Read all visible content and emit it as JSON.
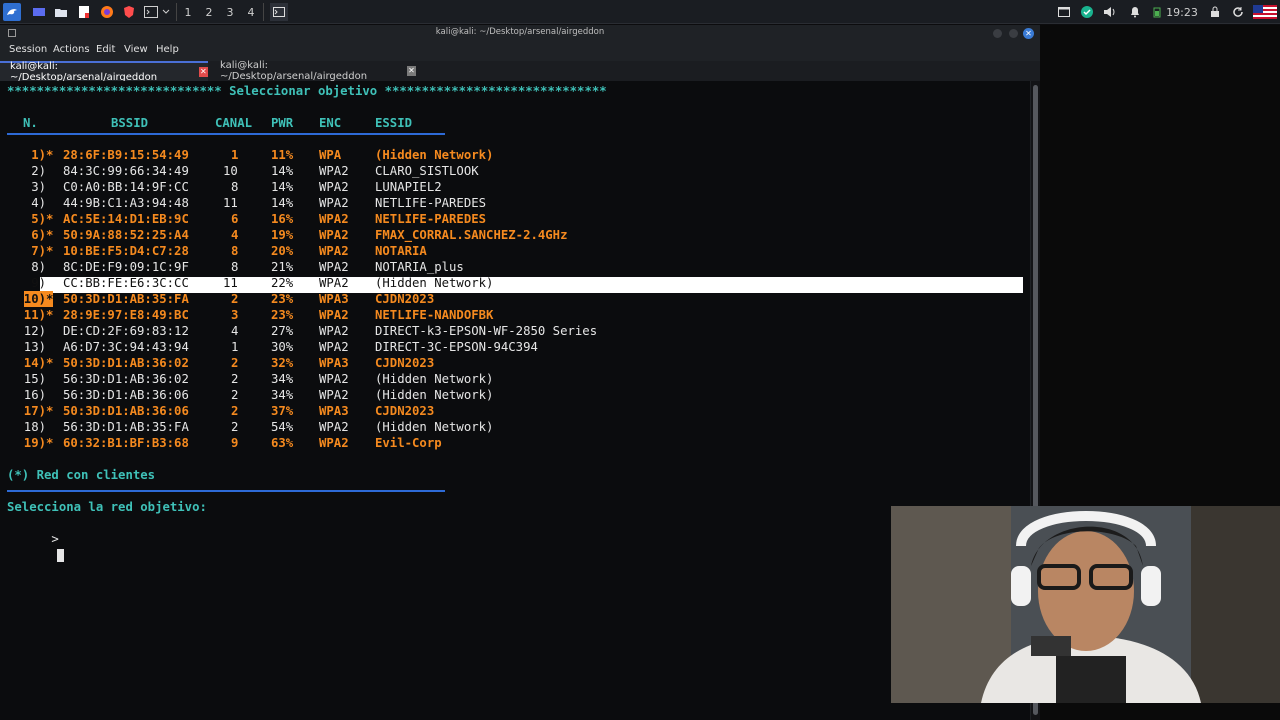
{
  "panel": {
    "workspaces": [
      "1",
      "2",
      "3",
      "4"
    ],
    "clock": "19:23"
  },
  "window": {
    "title": "kali@kali: ~/Desktop/arsenal/airgeddon",
    "menu": [
      "Session",
      "Actions",
      "Edit",
      "View",
      "Help"
    ],
    "tabs": [
      {
        "label": "kali@kali: ~/Desktop/arsenal/airgeddon"
      },
      {
        "label": "kali@kali: ~/Desktop/arsenal/airgeddon"
      }
    ]
  },
  "terminal": {
    "header": "***************************** Seleccionar objetivo ******************************",
    "columns": {
      "n": "N.",
      "bssid": "BSSID",
      "canal": "CANAL",
      "pwr": "PWR",
      "enc": "ENC",
      "essid": "ESSID"
    },
    "rows": [
      {
        "n": "1)*",
        "bssid": "28:6F:B9:15:54:49",
        "canal": "1",
        "pwr": "11%",
        "enc": "WPA",
        "essid": "(Hidden Network)",
        "clients": true
      },
      {
        "n": "2)",
        "bssid": "84:3C:99:66:34:49",
        "canal": "10",
        "pwr": "14%",
        "enc": "WPA2",
        "essid": "CLARO_SISTLOOK",
        "clients": false
      },
      {
        "n": "3)",
        "bssid": "C0:A0:BB:14:9F:CC",
        "canal": "8",
        "pwr": "14%",
        "enc": "WPA2",
        "essid": "LUNAPIEL2",
        "clients": false
      },
      {
        "n": "4)",
        "bssid": "44:9B:C1:A3:94:48",
        "canal": "11",
        "pwr": "14%",
        "enc": "WPA2",
        "essid": "NETLIFE-PAREDES",
        "clients": false
      },
      {
        "n": "5)*",
        "bssid": "AC:5E:14:D1:EB:9C",
        "canal": "6",
        "pwr": "16%",
        "enc": "WPA2",
        "essid": "NETLIFE-PAREDES",
        "clients": true
      },
      {
        "n": "6)*",
        "bssid": "50:9A:88:52:25:A4",
        "canal": "4",
        "pwr": "19%",
        "enc": "WPA2",
        "essid": "FMAX_CORRAL.SANCHEZ-2.4GHz",
        "clients": true
      },
      {
        "n": "7)*",
        "bssid": "10:BE:F5:D4:C7:28",
        "canal": "8",
        "pwr": "20%",
        "enc": "WPA2",
        "essid": "NOTARIA",
        "clients": true
      },
      {
        "n": "8)",
        "bssid": "8C:DE:F9:09:1C:9F",
        "canal": "8",
        "pwr": "21%",
        "enc": "WPA2",
        "essid": "NOTARIA_plus",
        "clients": false
      },
      {
        "n": "9)",
        "bssid": "CC:BB:FE:E6:3C:CC",
        "canal": "11",
        "pwr": "22%",
        "enc": "WPA2",
        "essid": "(Hidden Network)",
        "clients": false
      },
      {
        "n": "10)*",
        "bssid": "50:3D:D1:AB:35:FA",
        "canal": "2",
        "pwr": "23%",
        "enc": "WPA3",
        "essid": "CJDN2023",
        "clients": true
      },
      {
        "n": "11)*",
        "bssid": "28:9E:97:E8:49:BC",
        "canal": "3",
        "pwr": "23%",
        "enc": "WPA2",
        "essid": "NETLIFE-NANDOFBK",
        "clients": true
      },
      {
        "n": "12)",
        "bssid": "DE:CD:2F:69:83:12",
        "canal": "4",
        "pwr": "27%",
        "enc": "WPA2",
        "essid": "DIRECT-k3-EPSON-WF-2850 Series",
        "clients": false
      },
      {
        "n": "13)",
        "bssid": "A6:D7:3C:94:43:94",
        "canal": "1",
        "pwr": "30%",
        "enc": "WPA2",
        "essid": "DIRECT-3C-EPSON-94C394",
        "clients": false
      },
      {
        "n": "14)*",
        "bssid": "50:3D:D1:AB:36:02",
        "canal": "2",
        "pwr": "32%",
        "enc": "WPA3",
        "essid": "CJDN2023",
        "clients": true
      },
      {
        "n": "15)",
        "bssid": "56:3D:D1:AB:36:02",
        "canal": "2",
        "pwr": "34%",
        "enc": "WPA2",
        "essid": "(Hidden Network)",
        "clients": false
      },
      {
        "n": "16)",
        "bssid": "56:3D:D1:AB:36:06",
        "canal": "2",
        "pwr": "34%",
        "enc": "WPA2",
        "essid": "(Hidden Network)",
        "clients": false
      },
      {
        "n": "17)*",
        "bssid": "50:3D:D1:AB:36:06",
        "canal": "2",
        "pwr": "37%",
        "enc": "WPA3",
        "essid": "CJDN2023",
        "clients": true
      },
      {
        "n": "18)",
        "bssid": "56:3D:D1:AB:35:FA",
        "canal": "2",
        "pwr": "54%",
        "enc": "WPA2",
        "essid": "(Hidden Network)",
        "clients": false
      },
      {
        "n": "19)*",
        "bssid": "60:32:B1:BF:B3:68",
        "canal": "9",
        "pwr": "63%",
        "enc": "WPA2",
        "essid": "Evil-Corp",
        "clients": true
      }
    ],
    "legend": "(*) Red con clientes",
    "prompt_title": "Selecciona la red objetivo:",
    "prompt": ">",
    "colors": {
      "accent_cyan": "#3fc1b8",
      "client_orange": "#f58a1f",
      "separator_blue": "#2d6ad6"
    }
  }
}
